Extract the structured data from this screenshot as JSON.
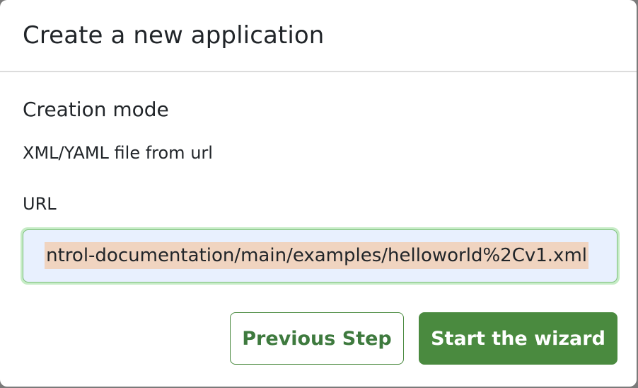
{
  "dialog": {
    "title": "Create a new application"
  },
  "form": {
    "creation_mode_label": "Creation mode",
    "creation_mode_value": "XML/YAML file from url",
    "url_label": "URL",
    "url_value": "ntrol-documentation/main/examples/helloworld%2Cv1.xml"
  },
  "buttons": {
    "previous_label": "Previous Step",
    "start_label": "Start the wizard"
  },
  "colors": {
    "primary": "#4a8a3f",
    "field_focus_ring": "#c6ecc6",
    "field_bg": "#e8f0fe",
    "selection_highlight": "#f0d4c0"
  }
}
